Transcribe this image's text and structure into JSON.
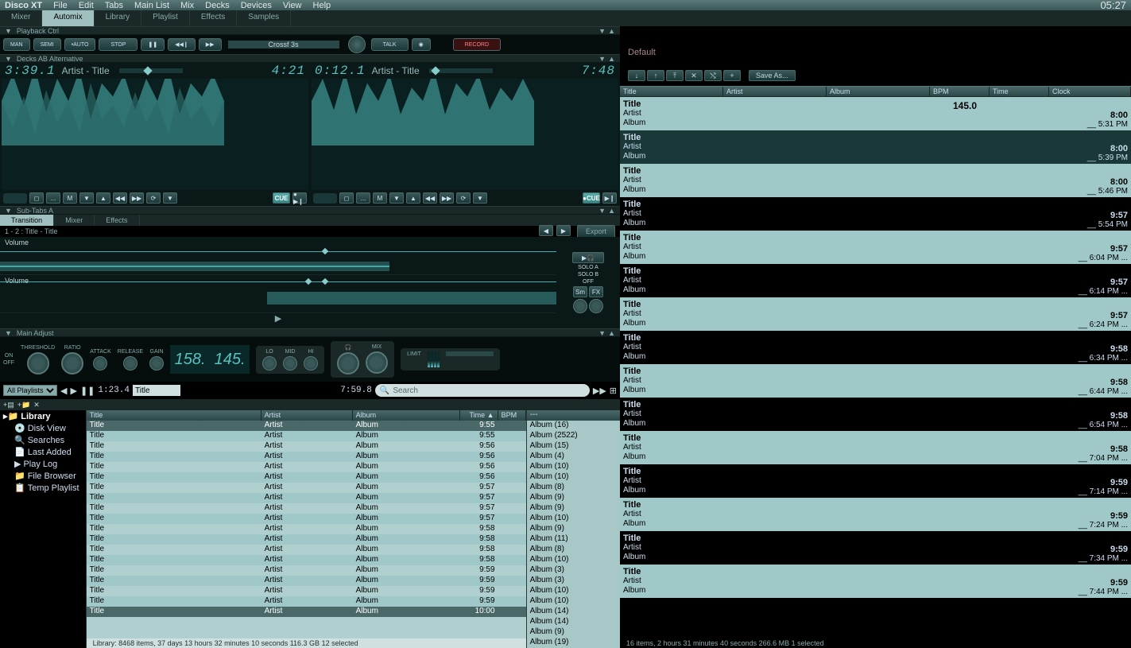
{
  "app": "Disco XT",
  "clock": "05:27",
  "menu": [
    "File",
    "Edit",
    "Tabs",
    "Main List",
    "Mix",
    "Decks",
    "Devices",
    "View",
    "Help"
  ],
  "tabs": [
    "Mixer",
    "Automix",
    "Library",
    "Playlist",
    "Effects",
    "Samples"
  ],
  "activeTab": 1,
  "sections": {
    "playback": "Playback Ctrl",
    "decks": "Decks AB Alternative",
    "subtabs": "Sub-Tabs A",
    "adjust": "Main Adjust"
  },
  "playback": {
    "buttons": [
      "MAN",
      "SEMI",
      "AUTO"
    ],
    "stop": "STOP",
    "crossf": "Crossf 3s",
    "talk": "TALK",
    "record": "RECORD"
  },
  "deckA": {
    "elapsed": "3:39.1",
    "remain": "4:21",
    "track": "Artist - Title"
  },
  "deckB": {
    "elapsed": "0:12.1",
    "remain": "7:48",
    "track": "Artist - Title"
  },
  "deckCtrl": {
    "m": "M",
    "cue": "CUE"
  },
  "subtabs": [
    "Transition",
    "Mixer",
    "Effects"
  ],
  "transition": {
    "title": "1 - 2 : Title - Title",
    "export": "Export",
    "volume": "Volume",
    "soloA": "SOLO A",
    "soloB": "SOLO B",
    "off": "OFF",
    "sm": "Sm",
    "fx": "FX"
  },
  "adjust": {
    "onoff": [
      "ON",
      "OFF"
    ],
    "labels": [
      "THRESHOLD",
      "RATIO",
      "ATTACK",
      "RELEASE",
      "GAIN"
    ],
    "bpm1": "158.",
    "bpm2": "145.",
    "eq": [
      "LO",
      "MID",
      "HI"
    ],
    "mix": "MIX",
    "limit": "LIMIT"
  },
  "library": {
    "playlists": "All Playlists",
    "nowtime": "1:23.4",
    "totaltime": "7:59.8",
    "searchPlaceholder": "Search",
    "sidebar": {
      "library": "Library",
      "items": [
        "Disk View",
        "Searches",
        "Last Added",
        "Play Log",
        "File Browser",
        "Temp Playlist"
      ]
    },
    "columns": {
      "title": "Title",
      "artist": "Artist",
      "album": "Album",
      "time": "Time",
      "bpm": "BPM"
    },
    "rows": [
      {
        "title": "Title",
        "artist": "Artist",
        "album": "Album",
        "time": "9:55",
        "sel": true
      },
      {
        "title": "Title",
        "artist": "Artist",
        "album": "Album",
        "time": "9:55"
      },
      {
        "title": "Title",
        "artist": "Artist",
        "album": "Album",
        "time": "9:56"
      },
      {
        "title": "Title",
        "artist": "Artist",
        "album": "Album",
        "time": "9:56"
      },
      {
        "title": "Title",
        "artist": "Artist",
        "album": "Album",
        "time": "9:56"
      },
      {
        "title": "Title",
        "artist": "Artist",
        "album": "Album",
        "time": "9:56"
      },
      {
        "title": "Title",
        "artist": "Artist",
        "album": "Album",
        "time": "9:57"
      },
      {
        "title": "Title",
        "artist": "Artist",
        "album": "Album",
        "time": "9:57"
      },
      {
        "title": "Title",
        "artist": "Artist",
        "album": "Album",
        "time": "9:57"
      },
      {
        "title": "Title",
        "artist": "Artist",
        "album": "Album",
        "time": "9:57"
      },
      {
        "title": "Title",
        "artist": "Artist",
        "album": "Album",
        "time": "9:58"
      },
      {
        "title": "Title",
        "artist": "Artist",
        "album": "Album",
        "time": "9:58"
      },
      {
        "title": "Title",
        "artist": "Artist",
        "album": "Album",
        "time": "9:58"
      },
      {
        "title": "Title",
        "artist": "Artist",
        "album": "Album",
        "time": "9:58"
      },
      {
        "title": "Title",
        "artist": "Artist",
        "album": "Album",
        "time": "9:59"
      },
      {
        "title": "Title",
        "artist": "Artist",
        "album": "Album",
        "time": "9:59"
      },
      {
        "title": "Title",
        "artist": "Artist",
        "album": "Album",
        "time": "9:59"
      },
      {
        "title": "Title",
        "artist": "Artist",
        "album": "Album",
        "time": "9:59"
      },
      {
        "title": "Title",
        "artist": "Artist",
        "album": "Album",
        "time": "10:00",
        "sel": true
      }
    ],
    "albumsHeader": "---",
    "albums": [
      "Album (16)",
      "Album (2522)",
      "Album (15)",
      "Album (4)",
      "Album (10)",
      "Album (10)",
      "Album (8)",
      "Album (9)",
      "Album (9)",
      "Album (10)",
      "Album (9)",
      "Album (11)",
      "Album (8)",
      "Album (10)",
      "Album (3)",
      "Album (3)",
      "Album (10)",
      "Album (10)",
      "Album (14)",
      "Album (14)",
      "Album (9)",
      "Album (19)"
    ],
    "status": "Library: 8468 items, 37 days 13 hours 32 minutes 10 seconds  116.3 GB  12 selected"
  },
  "right": {
    "default": "Default",
    "saveAs": "Save As...",
    "columns": {
      "title": "Title",
      "artist": "Artist",
      "album": "Album",
      "bpm": "BPM",
      "time": "Time",
      "clock": "Clock"
    },
    "rows": [
      {
        "title": "Title",
        "artist": "Artist",
        "album": "Album",
        "bpm": "145.0",
        "dur": "8:00",
        "clk": "__ 5:31 PM"
      },
      {
        "title": "Title",
        "artist": "Artist",
        "album": "Album",
        "bpm": "",
        "dur": "8:00",
        "clk": "__ 5:39 PM"
      },
      {
        "title": "Title",
        "artist": "Artist",
        "album": "Album",
        "bpm": "",
        "dur": "8:00",
        "clk": "__ 5:46 PM"
      },
      {
        "title": "Title",
        "artist": "Artist",
        "album": "Album",
        "bpm": "",
        "dur": "9:57",
        "clk": "__ 5:54 PM"
      },
      {
        "title": "Title",
        "artist": "Artist",
        "album": "Album",
        "bpm": "",
        "dur": "9:57",
        "clk": "__ 6:04 PM ..."
      },
      {
        "title": "Title",
        "artist": "Artist",
        "album": "Album",
        "bpm": "",
        "dur": "9:57",
        "clk": "__ 6:14 PM ..."
      },
      {
        "title": "Title",
        "artist": "Artist",
        "album": "Album",
        "bpm": "",
        "dur": "9:57",
        "clk": "__ 6:24 PM ..."
      },
      {
        "title": "Title",
        "artist": "Artist",
        "album": "Album",
        "bpm": "",
        "dur": "9:58",
        "clk": "__ 6:34 PM ..."
      },
      {
        "title": "Title",
        "artist": "Artist",
        "album": "Album",
        "bpm": "",
        "dur": "9:58",
        "clk": "__ 6:44 PM ..."
      },
      {
        "title": "Title",
        "artist": "Artist",
        "album": "Album",
        "bpm": "",
        "dur": "9:58",
        "clk": "__ 6:54 PM ..."
      },
      {
        "title": "Title",
        "artist": "Artist",
        "album": "Album",
        "bpm": "",
        "dur": "9:58",
        "clk": "__ 7:04 PM ..."
      },
      {
        "title": "Title",
        "artist": "Artist",
        "album": "Album",
        "bpm": "",
        "dur": "9:59",
        "clk": "__ 7:14 PM ..."
      },
      {
        "title": "Title",
        "artist": "Artist",
        "album": "Album",
        "bpm": "",
        "dur": "9:59",
        "clk": "__ 7:24 PM ..."
      },
      {
        "title": "Title",
        "artist": "Artist",
        "album": "Album",
        "bpm": "",
        "dur": "9:59",
        "clk": "__ 7:34 PM ..."
      },
      {
        "title": "Title",
        "artist": "Artist",
        "album": "Album",
        "bpm": "",
        "dur": "9:59",
        "clk": "__ 7:44 PM ..."
      }
    ],
    "status": "16 items, 2 hours 31 minutes 40 seconds  266.6 MB  1 selected"
  }
}
